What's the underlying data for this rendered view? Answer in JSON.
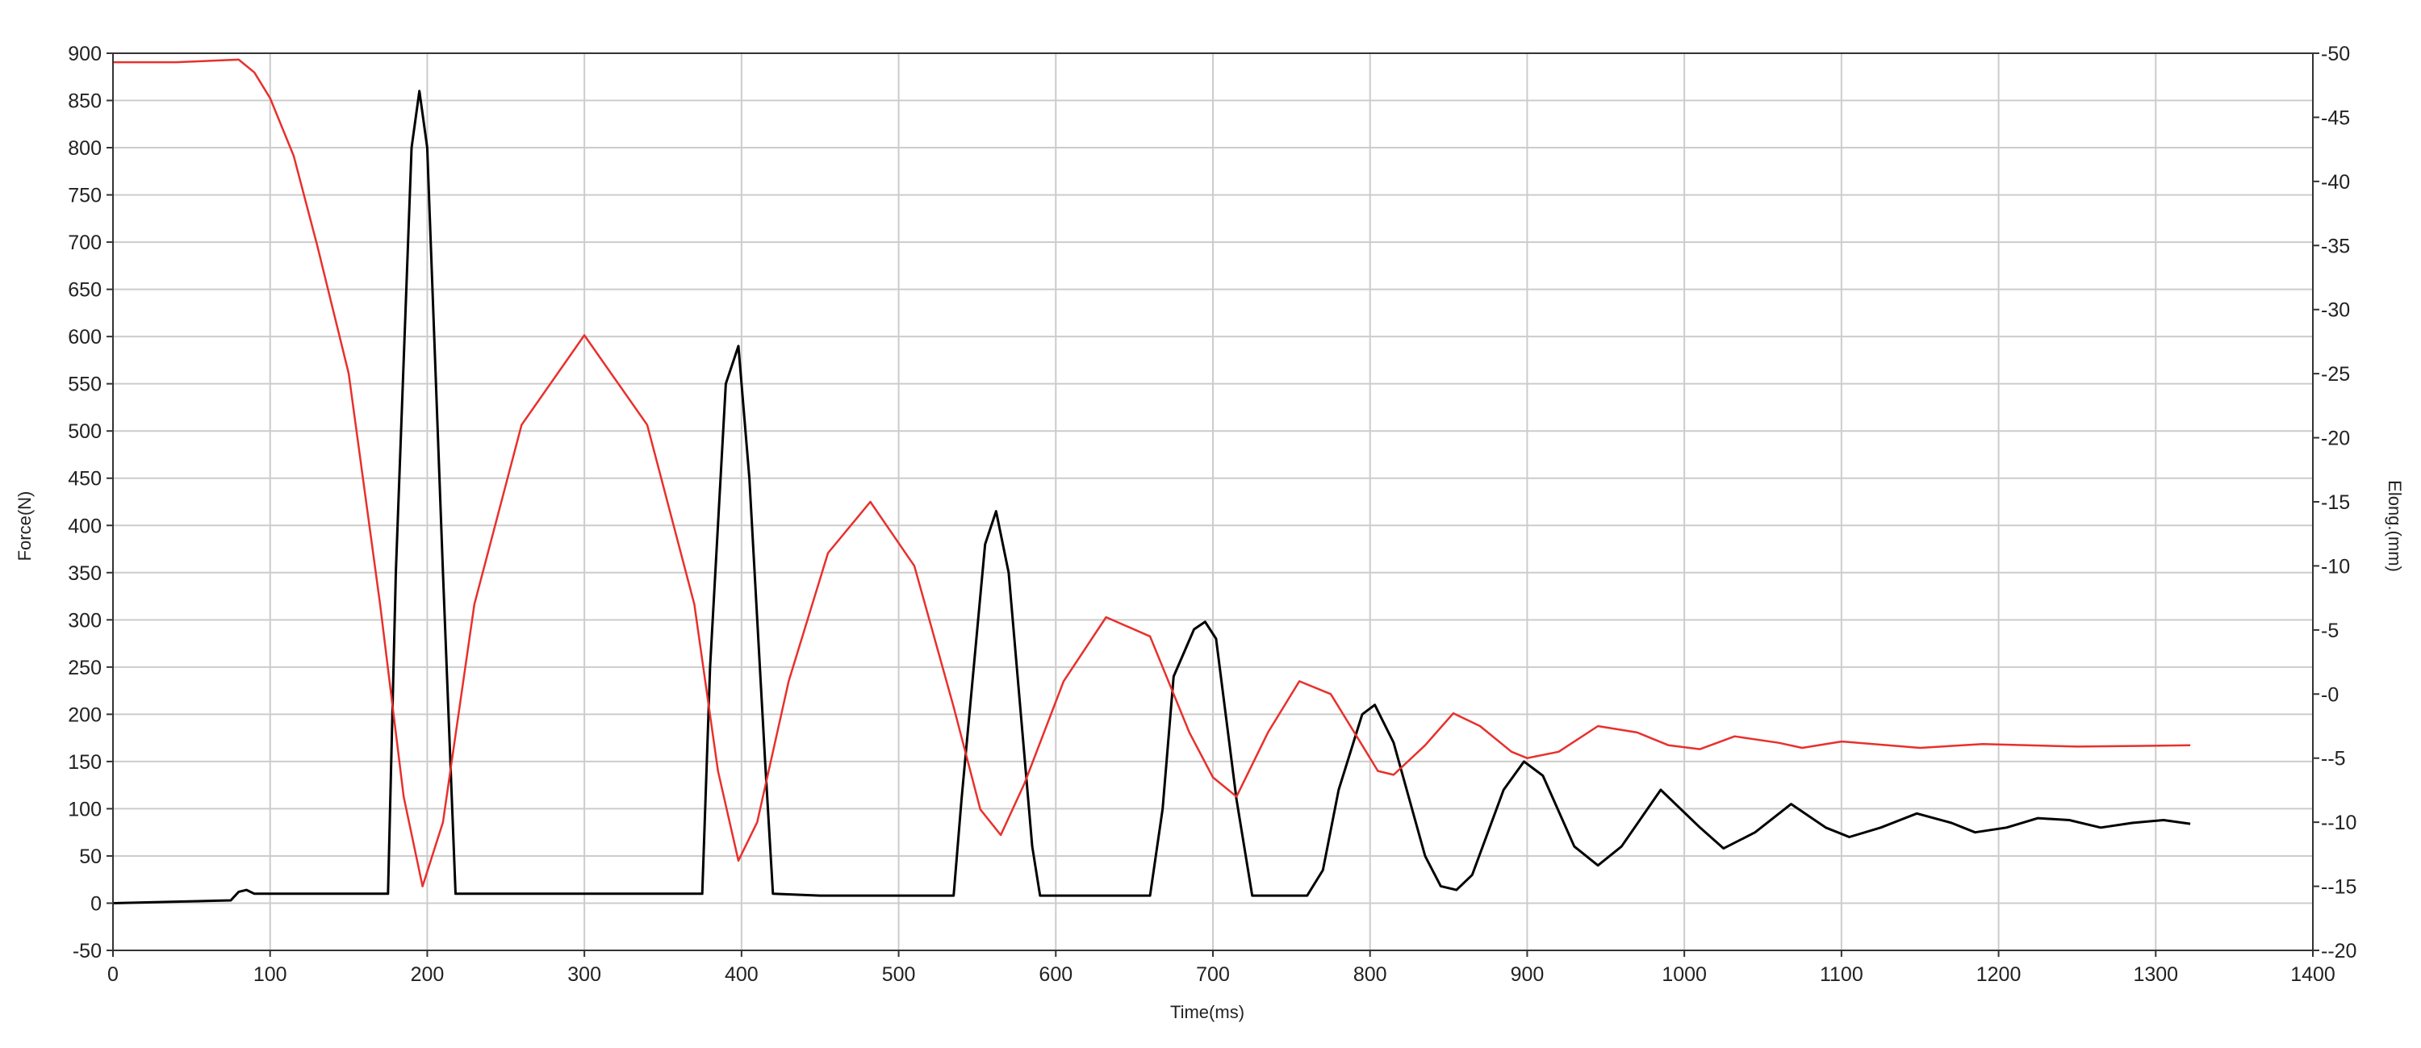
{
  "chart_data": {
    "type": "line",
    "title": "",
    "xlabel": "Time(ms)",
    "ylabel": "Force(N)",
    "y2label": "Elong.(mm)",
    "xlim": [
      0,
      1400
    ],
    "ylim": [
      -50,
      900
    ],
    "y2lim": [
      -20,
      50
    ],
    "xticks": [
      0,
      100,
      200,
      300,
      400,
      500,
      600,
      700,
      800,
      900,
      1000,
      1100,
      1200,
      1300,
      1400
    ],
    "yticks": [
      -50,
      0,
      50,
      100,
      150,
      200,
      250,
      300,
      350,
      400,
      450,
      500,
      550,
      600,
      650,
      700,
      750,
      800,
      850,
      900
    ],
    "y2ticks": [
      -20,
      -15,
      -10,
      -5,
      0,
      5,
      10,
      15,
      20,
      25,
      30,
      35,
      40,
      45,
      50
    ],
    "grid": true,
    "legend": "none",
    "colors": {
      "force": "#000000",
      "elongation": "#e8302c",
      "grid": "#cccccc",
      "axis": "#333333"
    },
    "series": [
      {
        "axis": "left",
        "color": "#000000",
        "x": [
          0,
          75,
          80,
          85,
          90,
          100,
          150,
          175,
          180,
          190,
          195,
          200,
          210,
          218,
          250,
          350,
          375,
          380,
          390,
          398,
          405,
          415,
          420,
          450,
          500,
          535,
          540,
          555,
          562,
          570,
          585,
          590,
          620,
          660,
          668,
          675,
          688,
          695,
          702,
          715,
          725,
          760,
          770,
          780,
          795,
          803,
          815,
          835,
          845,
          855,
          865,
          885,
          898,
          910,
          930,
          945,
          960,
          985,
          1010,
          1025,
          1045,
          1068,
          1090,
          1105,
          1125,
          1148,
          1170,
          1185,
          1205,
          1225,
          1245,
          1265,
          1285,
          1305,
          1322
        ],
        "values": [
          0,
          3,
          12,
          14,
          10,
          10,
          10,
          10,
          350,
          800,
          860,
          800,
          350,
          10,
          10,
          10,
          10,
          250,
          550,
          590,
          450,
          150,
          10,
          8,
          8,
          8,
          110,
          380,
          415,
          350,
          60,
          8,
          8,
          8,
          100,
          240,
          290,
          298,
          280,
          110,
          8,
          8,
          35,
          120,
          200,
          210,
          170,
          50,
          18,
          14,
          30,
          120,
          150,
          135,
          60,
          40,
          60,
          120,
          80,
          58,
          75,
          105,
          80,
          70,
          80,
          95,
          85,
          75,
          80,
          90,
          88,
          80,
          85,
          88,
          84
        ]
      },
      {
        "axis": "right",
        "color": "#e8302c",
        "x": [
          0,
          40,
          80,
          90,
          100,
          115,
          130,
          150,
          170,
          185,
          197,
          210,
          230,
          260,
          300,
          340,
          370,
          385,
          398,
          410,
          430,
          455,
          482,
          510,
          535,
          552,
          565,
          580,
          605,
          632,
          660,
          685,
          700,
          715,
          735,
          755,
          775,
          795,
          805,
          815,
          835,
          853,
          870,
          890,
          900,
          920,
          945,
          970,
          990,
          1010,
          1032,
          1060,
          1075,
          1100,
          1150,
          1190,
          1250,
          1322
        ],
        "values": [
          49.3,
          49.3,
          49.5,
          48.5,
          46.5,
          42,
          35,
          25,
          7,
          -8,
          -15,
          -10,
          7,
          21,
          28,
          21,
          7,
          -6,
          -13,
          -10,
          1,
          11,
          15,
          10,
          -1,
          -9,
          -11,
          -7,
          1,
          6,
          4.5,
          -3,
          -6.5,
          -8,
          -3,
          1,
          0,
          -4,
          -6,
          -6.3,
          -4,
          -1.5,
          -2.5,
          -4.5,
          -5,
          -4.5,
          -2.5,
          -3,
          -4,
          -4.3,
          -3.3,
          -3.8,
          -4.2,
          -3.7,
          -4.2,
          -3.9,
          -4.1,
          -4
        ]
      }
    ]
  }
}
